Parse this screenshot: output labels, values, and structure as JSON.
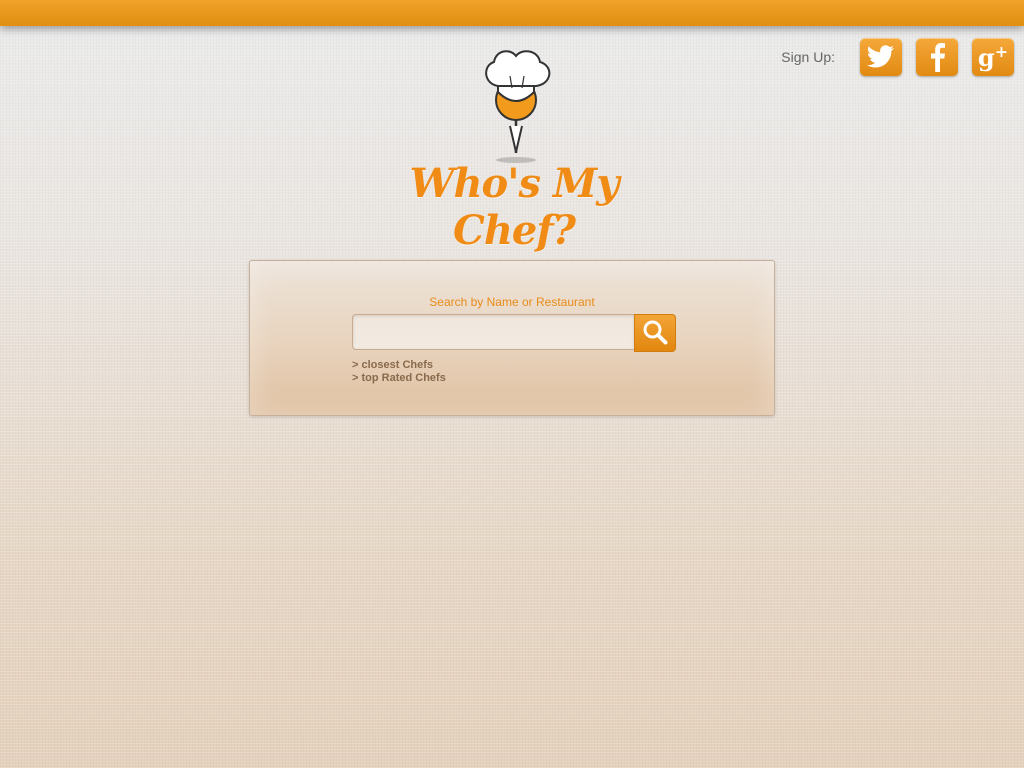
{
  "header": {
    "signup_label": "Sign Up:",
    "social": [
      {
        "name": "twitter-icon"
      },
      {
        "name": "facebook-icon"
      },
      {
        "name": "google-plus-icon"
      }
    ]
  },
  "brand": {
    "title": "Who's My Chef?"
  },
  "search": {
    "label": "Search by Name or Restaurant",
    "value": "",
    "placeholder": "",
    "button_icon": "search-icon"
  },
  "links": [
    "> closest Chefs",
    "> top Rated Chefs"
  ],
  "colors": {
    "accent": "#f08c16",
    "topbar": "#e8961c",
    "link": "#8a6a4c"
  }
}
